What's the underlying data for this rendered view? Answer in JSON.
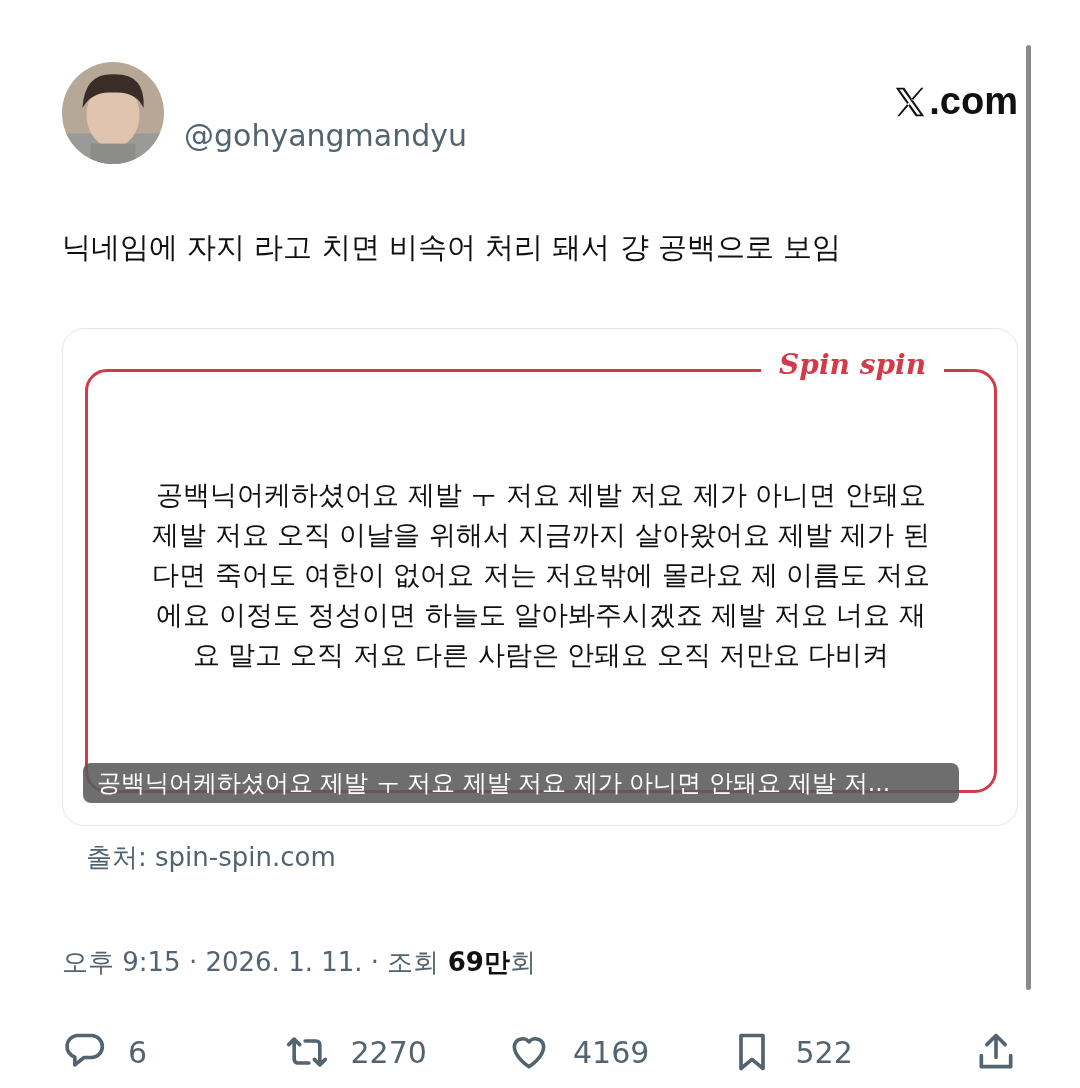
{
  "header": {
    "handle": "@gohyangmandyu",
    "site_suffix": ".com"
  },
  "tweet": {
    "text": "닉네임에 자지 라고 치면 비속어 처리 돼서 걍 공백으로 보임"
  },
  "card": {
    "logo": "Spin spin",
    "body": "공백닉어케하셨어요 제발 ㅜ 저요 제발 저요 제가 아니면 안돼요 제발 저요 오직 이날을 위해서 지금까지 살아왔어요 제발 제가 된다면 죽어도 여한이 없어요 저는 저요밖에 몰라요 제 이름도 저요에요 이정도 정성이면 하늘도 알아봐주시겠죠 제발 저요 너요 재요 말고 오직 저요 다른 사람은 안돼요 오직 저만요 다비켜",
    "caption": "공백닉어케하셨어요 제발 ㅜ 저요 제발 저요 제가 아니면 안돼요 제발 저..."
  },
  "source": "출처: spin-spin.com",
  "meta": "오후 9:15 · 2026. 1. 11. · 조회 **69만**회",
  "actions": [
    {
      "kind": "reply",
      "count": "6"
    },
    {
      "kind": "repost",
      "count": "2270"
    },
    {
      "kind": "like",
      "count": "4169"
    },
    {
      "kind": "bookmark",
      "count": "522"
    },
    {
      "kind": "share"
    }
  ]
}
